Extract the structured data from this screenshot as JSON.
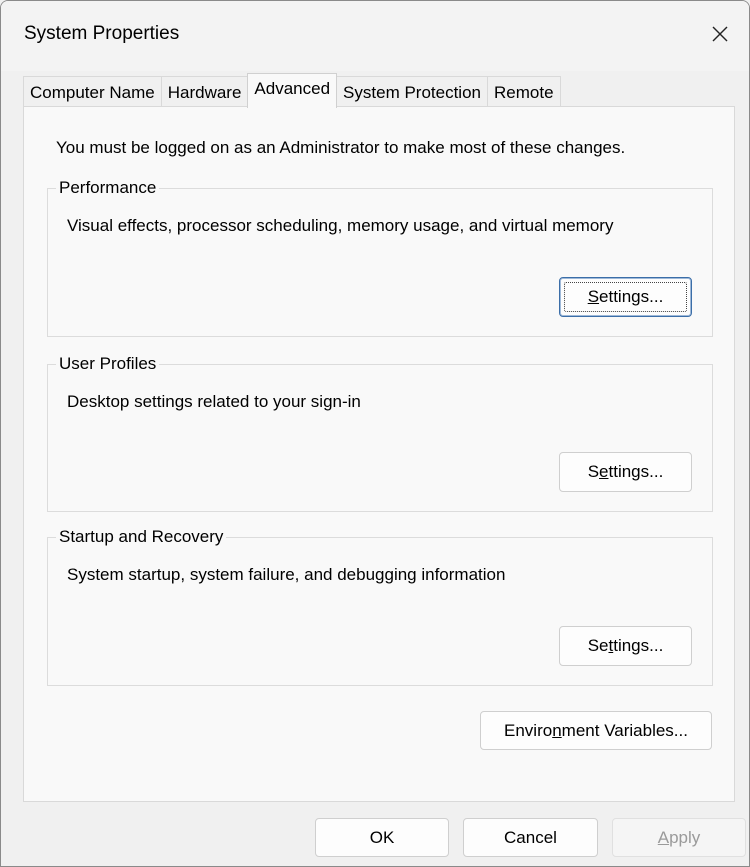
{
  "window": {
    "title": "System Properties"
  },
  "tabs": [
    {
      "label": "Computer Name",
      "active": false
    },
    {
      "label": "Hardware",
      "active": false
    },
    {
      "label": "Advanced",
      "active": true
    },
    {
      "label": "System Protection",
      "active": false
    },
    {
      "label": "Remote",
      "active": false
    }
  ],
  "advanced": {
    "admin_note": "You must be logged on as an Administrator to make most of these changes.",
    "performance": {
      "title": "Performance",
      "description": "Visual effects, processor scheduling, memory usage, and virtual memory",
      "button": {
        "pre": "",
        "accel": "S",
        "post": "ettings..."
      }
    },
    "user_profiles": {
      "title": "User Profiles",
      "description": "Desktop settings related to your sign-in",
      "button": {
        "pre": "S",
        "accel": "e",
        "post": "ttings..."
      }
    },
    "startup_recovery": {
      "title": "Startup and Recovery",
      "description": "System startup, system failure, and debugging information",
      "button": {
        "pre": "Se",
        "accel": "t",
        "post": "tings..."
      }
    },
    "env_button": {
      "pre": "Enviro",
      "accel": "n",
      "post": "ment Variables..."
    }
  },
  "footer": {
    "ok": "OK",
    "cancel": "Cancel",
    "apply": {
      "pre": "",
      "accel": "A",
      "post": "pply"
    }
  },
  "icons": {
    "close": "close-icon"
  }
}
